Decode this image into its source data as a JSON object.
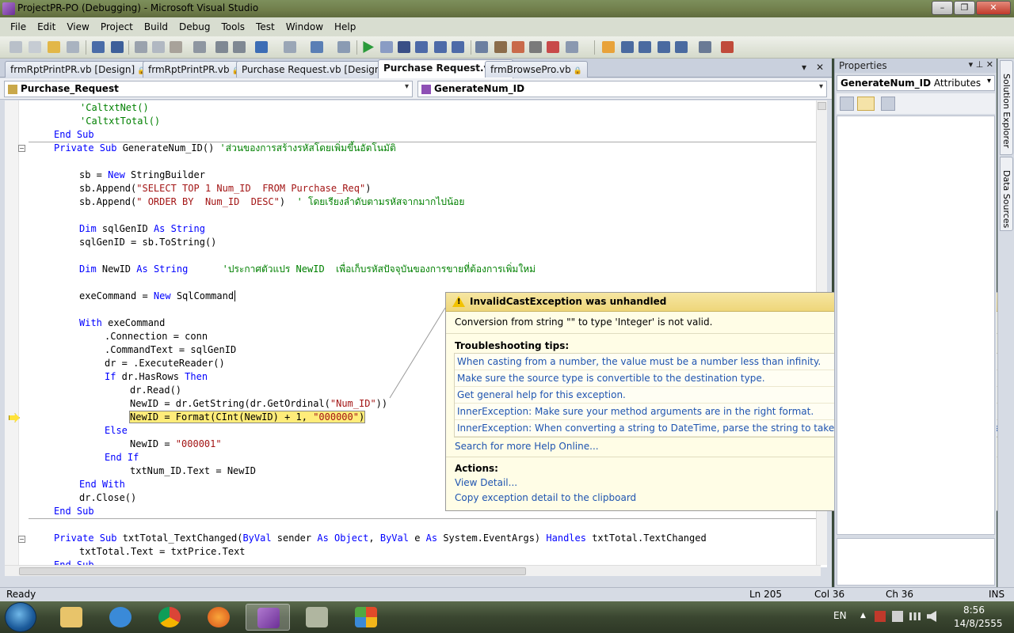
{
  "window": {
    "title": "ProjectPR-PO (Debugging) - Microsoft Visual Studio",
    "buttons": [
      "–",
      "❐",
      "✕"
    ]
  },
  "menu": [
    "File",
    "Edit",
    "View",
    "Project",
    "Build",
    "Debug",
    "Tools",
    "Test",
    "Window",
    "Help"
  ],
  "tabs": [
    {
      "label": "frmRptPrintPR.vb [Design]",
      "active": false
    },
    {
      "label": "frmRptPrintPR.vb",
      "active": false
    },
    {
      "label": "Purchase Request.vb [Design]",
      "active": false
    },
    {
      "label": "Purchase Request.vb",
      "active": true
    },
    {
      "label": "frmBrowsePro.vb",
      "active": false
    }
  ],
  "tab_controls": {
    "dropdown": "▾",
    "close": "✕"
  },
  "combos": {
    "class_name": "Purchase_Request",
    "method_name": "GenerateNum_ID",
    "arrow": "▾"
  },
  "code": {
    "l1": "'CaltxtNet()",
    "l2": "'CaltxtTotal()",
    "l3": "End Sub",
    "l4_kw1": "Private Sub",
    "l4_rest": " GenerateNum_ID() ",
    "l4_cm": "'ส่วนของการสร้างรหัสโดยเพิ่มขึ้นอัตโนมัติ",
    "l6_a": "sb = ",
    "l6_kw": "New",
    "l6_b": " StringBuilder",
    "l7_a": "sb.Append(",
    "l7_s": "\"SELECT TOP 1 Num_ID  FROM Purchase_Req\"",
    "l7_b": ")",
    "l8_a": "sb.Append(",
    "l8_s": "\" ORDER BY  Num_ID  DESC\"",
    "l8_b": ")  ",
    "l8_cm": "' โดยเรียงลำดับตามรหัสจากมากไปน้อย",
    "l10_kw": "Dim",
    "l10_a": " sqlGenID ",
    "l10_kw2": "As String",
    "l11": "sqlGenID = sb.ToString()",
    "l13_kw": "Dim",
    "l13_a": " NewID ",
    "l13_kw2": "As String",
    "l13_cm": "      'ประกาศตัวแปร NewID  เพื่อเก็บรหัสปัจจุบันของการขายที่ต้องการเพิ่มใหม่",
    "l15_a": "exeCommand = ",
    "l15_kw": "New",
    "l15_b": " SqlCommand",
    "l17_kw": "With",
    "l17_a": " exeCommand",
    "l18": ".Connection = conn",
    "l19": ".CommandText = sqlGenID",
    "l20": "dr = .ExecuteReader()",
    "l21_kw": "If",
    "l21_a": " dr.HasRows ",
    "l21_kw2": "Then",
    "l22": "dr.Read()",
    "l23_a": "NewID = dr.GetString(dr.GetOrdinal(",
    "l23_s": "\"Num_ID\"",
    "l23_b": "))",
    "l24_a": "NewID = Format(CInt(NewID) + 1, ",
    "l24_s": "\"000000\"",
    "l24_b": ")",
    "l25_kw": "Else",
    "l26_a": "NewID = ",
    "l26_s": "\"000001\"",
    "l27_kw": "End If",
    "l28": "txtNum_ID.Text = NewID",
    "l29_kw": "End With",
    "l30": "dr.Close()",
    "l31_kw": "End Sub",
    "l33_kw": "Private Sub",
    "l33_a": " txtTotal_TextChanged(",
    "l33_kw2": "ByVal",
    "l33_b": " sender ",
    "l33_kw3": "As Object",
    "l33_c": ", ",
    "l33_kw4": "ByVal",
    "l33_d": " e ",
    "l33_kw5": "As",
    "l33_e": " System.EventArgs) ",
    "l33_kw6": "Handles",
    "l33_f": " txtTotal.TextChanged",
    "l34": "txtTotal.Text = txtPrice.Text",
    "l35_kw": "End Sub"
  },
  "exception": {
    "title": "InvalidCastException was unhandled",
    "message": "Conversion from string \"\" to type 'Integer' is not valid.",
    "tips_heading": "Troubleshooting tips:",
    "tips": [
      "When casting from a number, the value must be a number less than infinity.",
      "Make sure the source type is convertible to the destination type.",
      "Get general help for this exception.",
      "InnerException: Make sure your method arguments are in the right format.",
      "InnerException: When converting a string to DateTime, parse the string to take the date before putting each variable into the DateTime"
    ],
    "search_link": "Search for more Help Online...",
    "actions_heading": "Actions:",
    "actions": [
      "View Detail...",
      "Copy exception detail to the clipboard"
    ]
  },
  "properties": {
    "header": "Properties",
    "header_controls": "▾ ⊥ ✕",
    "object": "GenerateNum_ID",
    "object_type": "Attributes",
    "arrow": "▾"
  },
  "side_tabs": [
    "Solution Explorer",
    "Data Sources"
  ],
  "status": {
    "state": "Ready",
    "ln": "Ln 205",
    "col": "Col 36",
    "ch": "Ch 36",
    "mode": "INS"
  },
  "tray": {
    "lang": "EN",
    "time": "8:56",
    "date": "14/8/2555",
    "arrow": "▲"
  },
  "colors": {
    "highlight": "#ffec7a",
    "keyword": "#0000ff",
    "string": "#a31515",
    "comment": "#008000",
    "link": "#1f54b0"
  }
}
